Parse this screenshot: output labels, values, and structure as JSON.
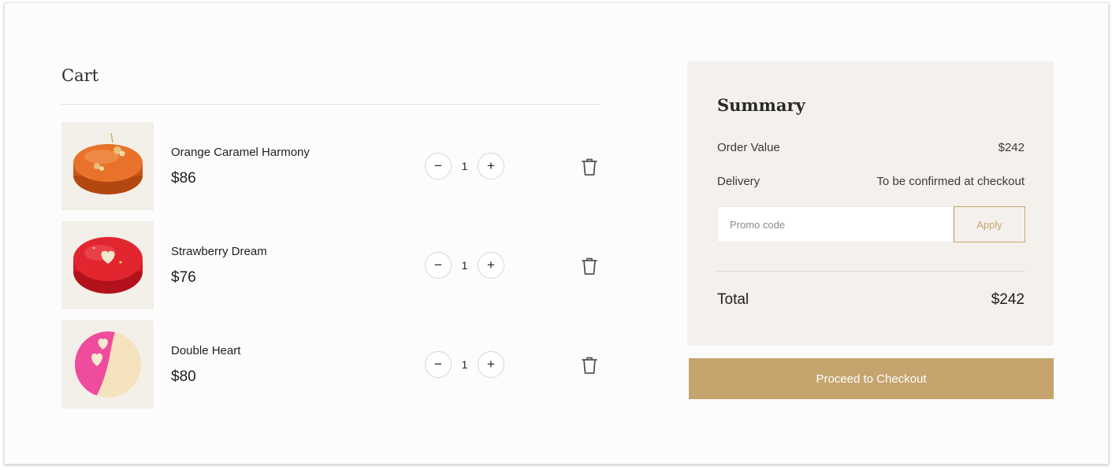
{
  "cart": {
    "title": "Cart",
    "items": [
      {
        "name": "Orange Caramel Harmony",
        "price": "$86",
        "quantity": "1",
        "image": "orange-caramel-cake",
        "color": "#e06a1e"
      },
      {
        "name": "Strawberry Dream",
        "price": "$76",
        "quantity": "1",
        "image": "strawberry-cake",
        "color": "#e0242e"
      },
      {
        "name": "Double Heart",
        "price": "$80",
        "quantity": "1",
        "image": "pink-cream-heart-cake",
        "color": "#f05aa0"
      }
    ],
    "decrement_symbol": "−",
    "increment_symbol": "+",
    "delete_icon": "trash-icon"
  },
  "summary": {
    "title": "Summary",
    "order_value_label": "Order Value",
    "order_value": "$242",
    "delivery_label": "Delivery",
    "delivery_value": "To be confirmed at checkout",
    "promo_placeholder": "Promo code",
    "apply_label": "Apply",
    "total_label": "Total",
    "total_value": "$242"
  },
  "checkout_label": "Proceed to Checkout",
  "colors": {
    "accent": "#c6a46e",
    "summary_bg": "#f4f1ed",
    "thumb_bg": "#f3efe9"
  }
}
